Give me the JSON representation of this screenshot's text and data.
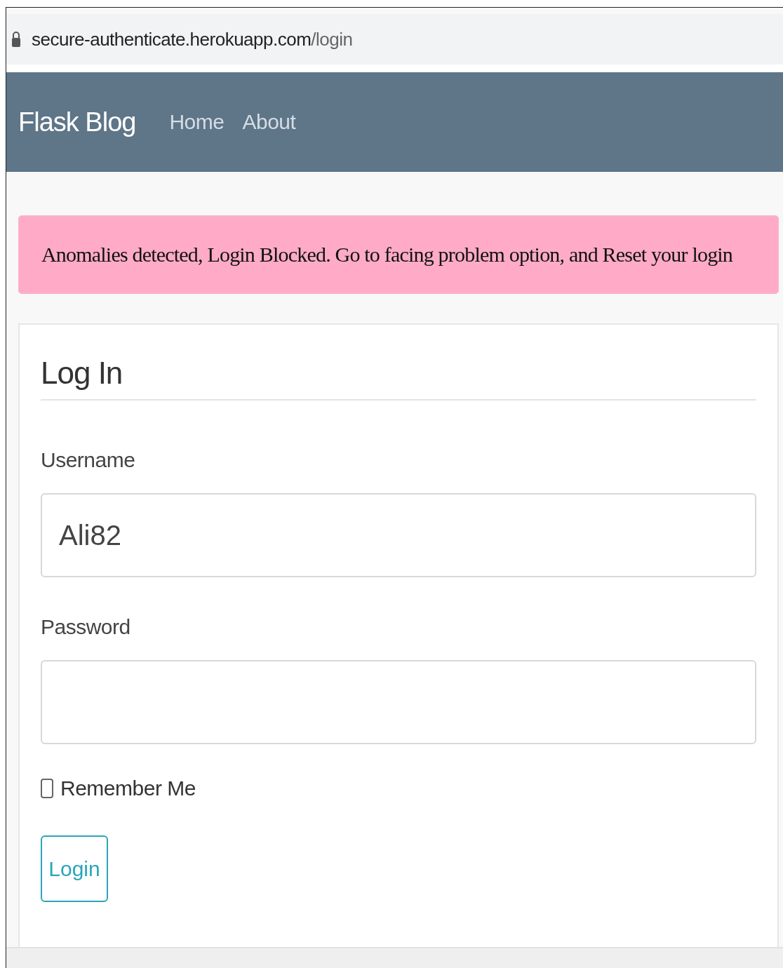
{
  "address_bar": {
    "host": "secure-authenticate.herokuapp.com",
    "path": "/login"
  },
  "navbar": {
    "brand": "Flask Blog",
    "links": [
      "Home",
      "About"
    ]
  },
  "alert": {
    "message": "Anomalies detected, Login Blocked. Go to facing problem option, and Reset your login"
  },
  "form": {
    "title": "Log In",
    "fields": [
      {
        "label": "Username",
        "value": "Ali82"
      },
      {
        "label": "Password"
      }
    ],
    "remember": {
      "label": "Remember Me",
      "checked": false
    },
    "submit": "Login"
  }
}
